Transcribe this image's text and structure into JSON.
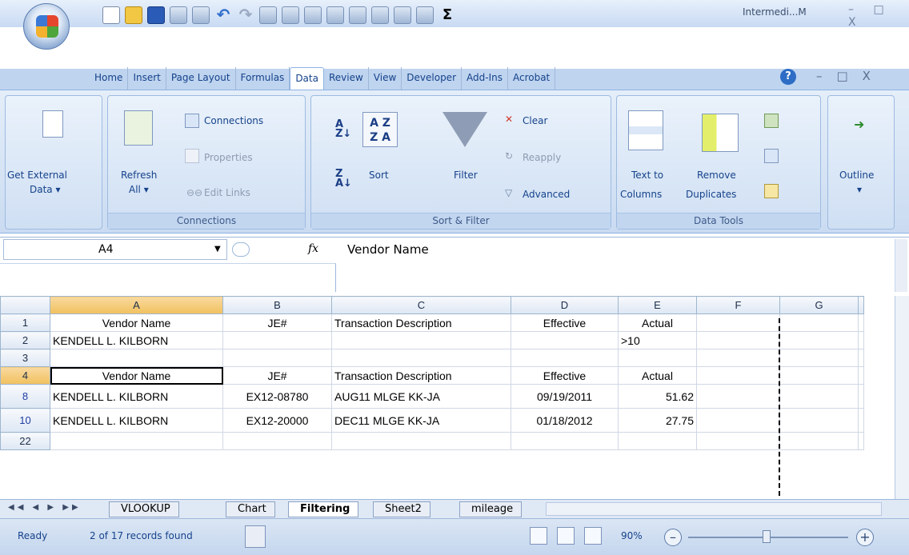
{
  "window": {
    "title": "Intermedi...M",
    "controls": "– □ X"
  },
  "ribbon_tabs": [
    "Home",
    "Insert",
    "Page Layout",
    "Formulas",
    "Data",
    "Review",
    "View",
    "Developer",
    "Add-Ins",
    "Acrobat"
  ],
  "active_tab": "Data",
  "groups": {
    "get_external": {
      "label1": "Get External",
      "label2": "Data ▾"
    },
    "connections": {
      "refresh1": "Refresh",
      "refresh2": "All ▾",
      "connections": "Connections",
      "properties": "Properties",
      "edit_links": "Edit Links",
      "group": "Connections"
    },
    "sort_filter": {
      "sort": "Sort",
      "filter": "Filter",
      "clear": "Clear",
      "reapply": "Reapply",
      "advanced": "Advanced",
      "group": "Sort & Filter"
    },
    "data_tools": {
      "text_to1": "Text to",
      "text_to2": "Columns",
      "remove1": "Remove",
      "remove2": "Duplicates",
      "group": "Data Tools"
    },
    "outline": {
      "label": "Outline",
      "arrow": "▾"
    }
  },
  "formula_bar": {
    "name_box": "A4",
    "fx": "fx",
    "value": "Vendor Name"
  },
  "columns": [
    "A",
    "B",
    "C",
    "D",
    "E",
    "F",
    "G"
  ],
  "rows": [
    {
      "num": "1",
      "cells": [
        "Vendor Name",
        "JE#",
        "Transaction Description",
        "Effective",
        "Actual",
        "",
        ""
      ]
    },
    {
      "num": "2",
      "cells": [
        "KENDELL L. KILBORN",
        "",
        "",
        "",
        ">10",
        "",
        ""
      ]
    },
    {
      "num": "3",
      "cells": [
        "",
        "",
        "",
        "",
        "",
        "",
        ""
      ]
    },
    {
      "num": "4",
      "cells": [
        "Vendor Name",
        "JE#",
        "Transaction Description",
        "Effective",
        "Actual",
        "",
        ""
      ]
    },
    {
      "num": "8",
      "cells": [
        "KENDELL L. KILBORN",
        "EX12-08780",
        "AUG11 MLGE KK-JA",
        "09/19/2011",
        "51.62",
        "",
        ""
      ]
    },
    {
      "num": "10",
      "cells": [
        "KENDELL L. KILBORN",
        "EX12-20000",
        "DEC11 MLGE KK-JA",
        "01/18/2012",
        "27.75",
        "",
        ""
      ]
    },
    {
      "num": "22",
      "cells": [
        "",
        "",
        "",
        "",
        "",
        "",
        ""
      ]
    }
  ],
  "sheet_tabs": [
    "VLOOKUP",
    "Chart",
    "Filtering",
    "Sheet2",
    "mileage"
  ],
  "active_sheet": "Filtering",
  "status": {
    "ready": "Ready",
    "records": "2 of 17 records found",
    "zoom": "90%"
  }
}
